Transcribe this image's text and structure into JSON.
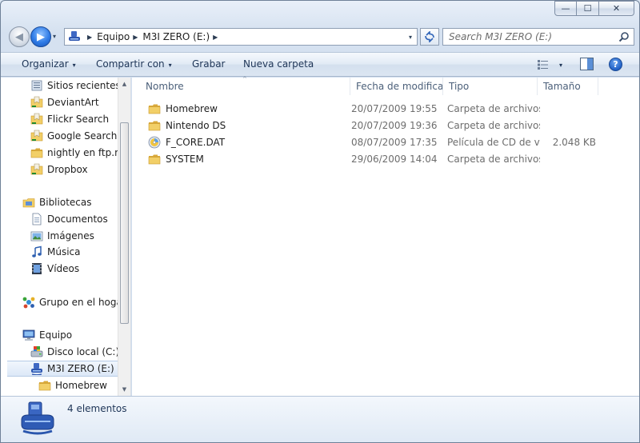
{
  "window": {
    "caption": {
      "min": "—",
      "max": "☐",
      "close": "✕"
    }
  },
  "nav": {
    "back_glyph": "◀",
    "forward_glyph": "▶",
    "dropdown_glyph": "▾"
  },
  "address": {
    "crumbs": [
      "Equipo",
      "M3I ZERO (E:)"
    ],
    "separator": "▶"
  },
  "search": {
    "placeholder": "Search M3I ZERO (E:)"
  },
  "toolbar": {
    "organize": "Organizar",
    "share": "Compartir con",
    "burn": "Grabar",
    "new_folder": "Nueva carpeta",
    "caret": "▾",
    "help": "?"
  },
  "navpane": {
    "items": [
      {
        "label": "Sitios recientes",
        "icon": "recent-places-icon"
      },
      {
        "label": "DeviantArt",
        "icon": "favorite-folder-icon"
      },
      {
        "label": "Flickr Search",
        "icon": "favorite-folder-icon"
      },
      {
        "label": "Google Search",
        "icon": "favorite-folder-icon"
      },
      {
        "label": "nightly en ftp.mo",
        "icon": "folder-icon"
      },
      {
        "label": "Dropbox",
        "icon": "favorite-folder-icon"
      },
      {
        "label": "Bibliotecas",
        "icon": "libraries-icon"
      },
      {
        "label": "Documentos",
        "icon": "documents-icon"
      },
      {
        "label": "Imágenes",
        "icon": "pictures-icon"
      },
      {
        "label": "Música",
        "icon": "music-icon"
      },
      {
        "label": "Vídeos",
        "icon": "videos-icon"
      },
      {
        "label": "Grupo en el hogar",
        "icon": "homegroup-icon"
      },
      {
        "label": "Equipo",
        "icon": "computer-icon"
      },
      {
        "label": "Disco local (C:)",
        "icon": "local-disk-icon"
      },
      {
        "label": "M3I ZERO (E:)",
        "icon": "removable-drive-icon"
      },
      {
        "label": "Homebrew",
        "icon": "folder-icon"
      }
    ],
    "scroll_up": "▲",
    "scroll_down": "▼"
  },
  "columns": {
    "name": "Nombre",
    "date": "Fecha de modifica...",
    "type": "Tipo",
    "size": "Tamaño",
    "sort_glyph": "^"
  },
  "files": [
    {
      "name": "Homebrew",
      "date": "20/07/2009 19:55",
      "type": "Carpeta de archivos",
      "size": "",
      "icon": "folder-icon"
    },
    {
      "name": "Nintendo DS",
      "date": "20/07/2009 19:36",
      "type": "Carpeta de archivos",
      "size": "",
      "icon": "folder-icon"
    },
    {
      "name": "F_CORE.DAT",
      "date": "08/07/2009 17:35",
      "type": "Película de CD de v...",
      "size": "2.048 KB",
      "icon": "vcd-file-icon"
    },
    {
      "name": "SYSTEM",
      "date": "29/06/2009 14:04",
      "type": "Carpeta de archivos",
      "size": "",
      "icon": "folder-icon"
    }
  ],
  "status": {
    "count": "4 elementos"
  },
  "colors": {
    "selection": "#dce8f7",
    "accent": "#2f7be6",
    "folder": "#e8c253"
  }
}
